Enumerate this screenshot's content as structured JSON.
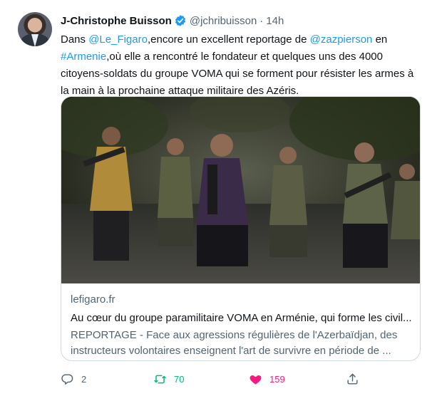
{
  "author": {
    "name": "J-Christophe Buisson",
    "handle": "@jchribuisson",
    "separator": "·",
    "time": "14h"
  },
  "tweet": {
    "t1": "Dans ",
    "m1": "@Le_Figaro",
    "t2": ",encore un excellent reportage de ",
    "m2": "@zazpierson",
    "t3": " en ",
    "h1": "#Armenie",
    "t4": ",où elle a rencontré le fondateur et quelques uns des 4000 citoyens-soldats du groupe VOMA qui se forment pour résister les armes à la main à la prochaine attaque militaire des Azéris."
  },
  "card": {
    "domain": "lefigaro.fr",
    "title": "Au cœur du groupe paramilitaire VOMA en Arménie, qui forme les civil...",
    "description": "REPORTAGE - Face aux agressions régulières de l'Azerbaïdjan, des instructeurs volontaires enseignent l'art de survivre en période de ..."
  },
  "actions": {
    "reply_count": "2",
    "retweet_count": "70",
    "like_count": "159"
  },
  "colors": {
    "link": "#1d9bf0",
    "retweet": "#00ba7c",
    "like": "#f91880",
    "muted": "#536471",
    "verified": "#1d9bf0"
  },
  "icons": [
    "verified-badge-icon",
    "reply-icon",
    "retweet-icon",
    "like-icon",
    "share-icon"
  ]
}
